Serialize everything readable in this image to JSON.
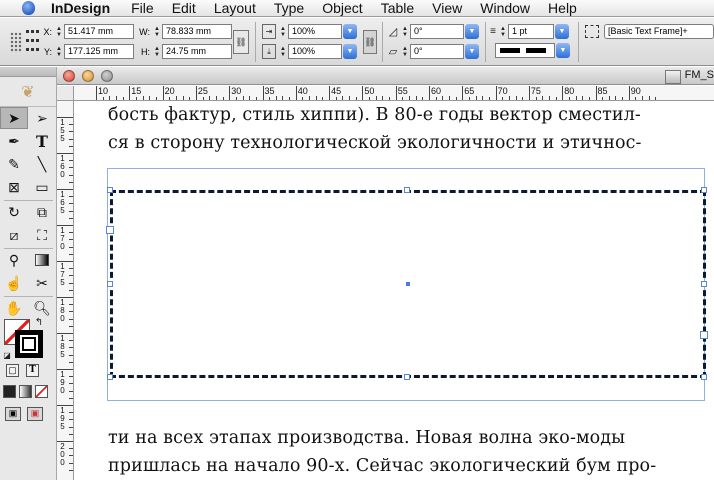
{
  "menubar": {
    "app_name": "InDesign",
    "items": [
      "File",
      "Edit",
      "Layout",
      "Type",
      "Object",
      "Table",
      "View",
      "Window",
      "Help"
    ]
  },
  "control_panel": {
    "x_label": "X:",
    "x_value": "51.417 mm",
    "y_label": "Y:",
    "y_value": "177.125 mm",
    "w_label": "W:",
    "w_value": "78.833 mm",
    "h_label": "H:",
    "h_value": "24.75 mm",
    "scale_x": "100%",
    "scale_y": "100%",
    "rotation": "0°",
    "shear": "0°",
    "stroke_weight": "1 pt",
    "object_style": "[Basic Text Frame]+"
  },
  "document": {
    "file_name": "FM_S"
  },
  "ruler": {
    "h_labels": [
      "10",
      "15",
      "20",
      "25",
      "30",
      "35",
      "40",
      "45",
      "50",
      "55",
      "60",
      "65",
      "70",
      "75",
      "80",
      "85",
      "90"
    ],
    "v_labels": [
      "155",
      "160",
      "165",
      "170",
      "175",
      "180",
      "185",
      "190",
      "195",
      "200"
    ]
  },
  "page_text": {
    "line1": "бость фактур, стиль хиппи). В 80-е годы вектор сместил-",
    "line2": "ся в сторону технологической экологичности и этичнос-",
    "line3": "ти на всех этапах производства. Новая волна эко-моды",
    "line4": "пришлась на начало 90-х. Сейчас экологический бум про-"
  },
  "icons": {
    "apple": "apple-logo-icon",
    "tools": [
      "selection-icon",
      "direct-selection-icon",
      "pen-icon",
      "type-icon",
      "pencil-icon",
      "line-icon",
      "rectangle-frame-icon",
      "rectangle-icon",
      "rotate-icon",
      "scale-icon",
      "shear-icon",
      "free-transform-icon",
      "eyedropper-icon",
      "gradient-icon",
      "button-icon",
      "scissors-icon",
      "hand-icon",
      "zoom-icon"
    ]
  }
}
